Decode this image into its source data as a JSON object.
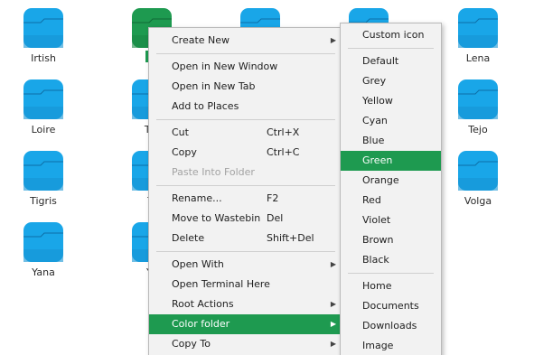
{
  "desktop": {
    "icons": [
      {
        "label": "Irtish",
        "color": "#19a6e8"
      },
      {
        "label": "",
        "color": "#1e9a50",
        "selected_label": "M"
      },
      {
        "label": "",
        "color": "#19a6e8"
      },
      {
        "label": "",
        "color": "#19a6e8"
      },
      {
        "label": "Lena",
        "color": "#19a6e8"
      },
      {
        "label": "Loire",
        "color": "#19a6e8"
      },
      {
        "label": "Tar",
        "color": "#19a6e8"
      },
      {
        "label": "Tejo",
        "color": "#19a6e8"
      },
      {
        "label": "Tigris",
        "color": "#19a6e8"
      },
      {
        "label": "Ti",
        "color": "#19a6e8"
      },
      {
        "label": "Volga",
        "color": "#19a6e8"
      },
      {
        "label": "Yana",
        "color": "#19a6e8"
      },
      {
        "label": "Ye",
        "color": "#19a6e8"
      }
    ]
  },
  "context_menu": {
    "create_new": "Create New",
    "open_new_window": "Open in New Window",
    "open_new_tab": "Open in New Tab",
    "add_to_places": "Add to Places",
    "cut": "Cut",
    "cut_shortcut": "Ctrl+X",
    "copy": "Copy",
    "copy_shortcut": "Ctrl+C",
    "paste_into_folder": "Paste Into Folder",
    "rename": "Rename...",
    "rename_shortcut": "F2",
    "move_to_wastebin": "Move to Wastebin",
    "move_shortcut": "Del",
    "delete": "Delete",
    "delete_shortcut": "Shift+Del",
    "open_with": "Open With",
    "open_terminal": "Open Terminal Here",
    "root_actions": "Root Actions",
    "color_folder": "Color folder",
    "copy_to": "Copy To",
    "submenu_arrow": "▶"
  },
  "color_submenu": {
    "custom_icon": "Custom icon",
    "colors": [
      "Default",
      "Grey",
      "Yellow",
      "Cyan",
      "Blue",
      "Green",
      "Orange",
      "Red",
      "Violet",
      "Brown",
      "Black"
    ],
    "selected_color": "Green",
    "places": [
      "Home",
      "Documents",
      "Downloads",
      "Image"
    ]
  },
  "theme": {
    "accent": "#1e9a50",
    "folder_blue": "#19a6e8",
    "menu_bg": "#f2f2f2"
  }
}
